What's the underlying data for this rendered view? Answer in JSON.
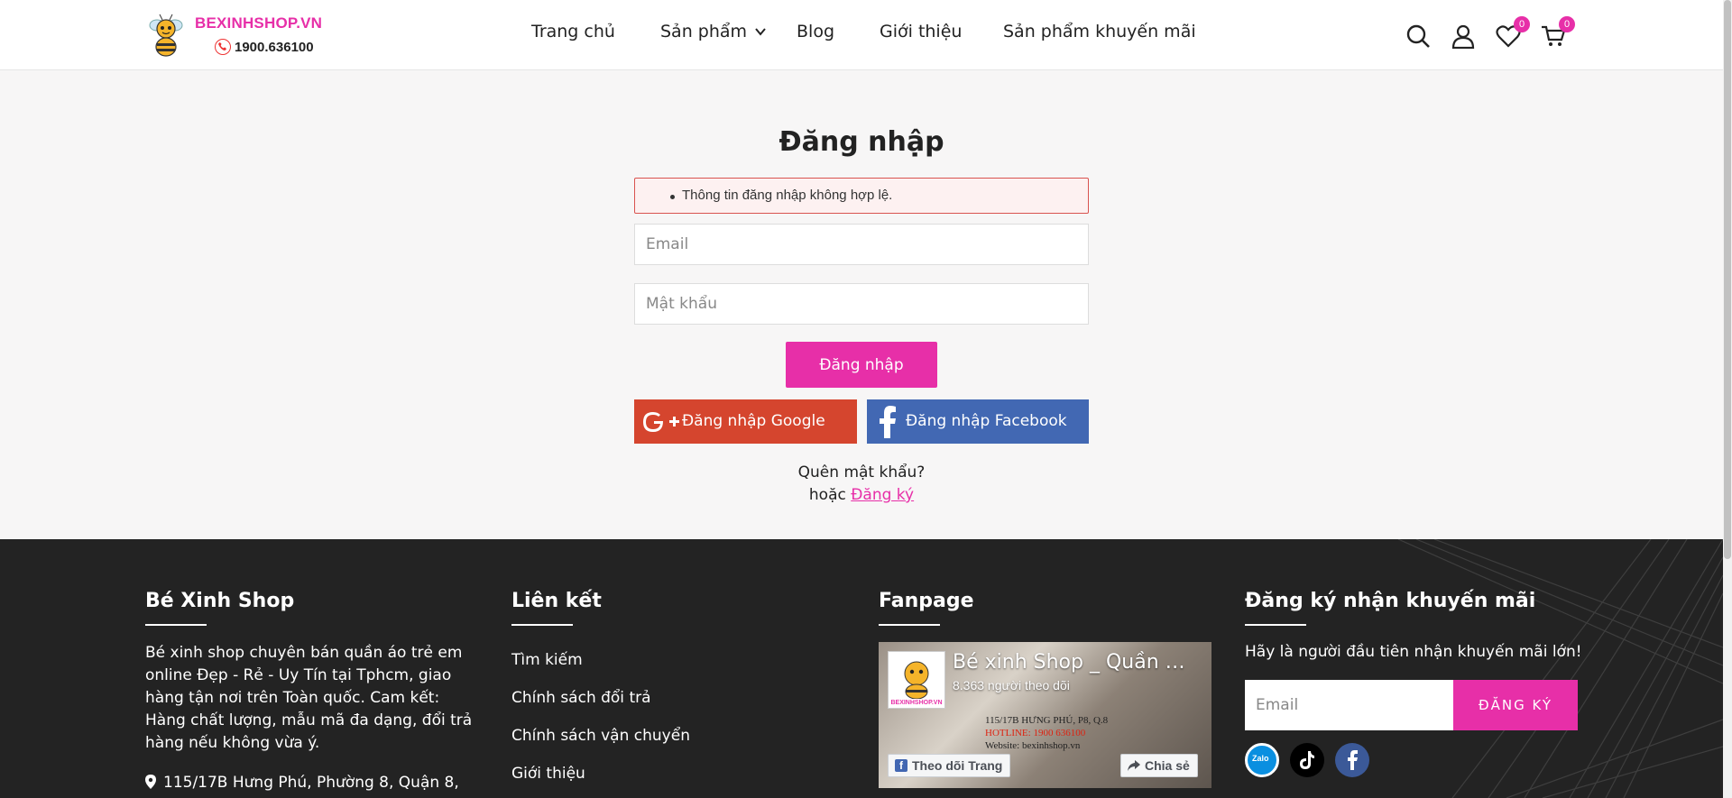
{
  "header": {
    "brand": "BEXINHSHOP.VN",
    "hotline": "1900.636100",
    "nav": [
      "Trang chủ",
      "Sản phẩm",
      "Blog",
      "Giới thiệu",
      "Sản phẩm khuyến mãi"
    ],
    "wishlist_count": "0",
    "cart_count": "0",
    "icons": [
      "search-icon",
      "user-icon",
      "heart-icon",
      "cart-icon"
    ]
  },
  "login": {
    "title": "Đăng nhập",
    "error": "Thông tin đăng nhập không hợp lệ.",
    "email_placeholder": "Email",
    "password_placeholder": "Mật khẩu",
    "submit": "Đăng nhập",
    "google": "Đăng nhập Google",
    "facebook": "Đăng nhập Facebook",
    "forgot": "Quên mật khẩu?",
    "or": "hoặc",
    "register": "Đăng ký"
  },
  "footer": {
    "about_title": "Bé Xinh Shop",
    "about_text": "Bé xinh shop chuyên bán quần áo trẻ em online Đẹp - Rẻ - Uy Tín tại Tphcm, giao hàng tận nơi trên Toàn quốc. Cam kết: Hàng chất lượng, mẫu mã đa dạng, đổi trả hàng nếu không vừa ý.",
    "address": "115/17B Hưng Phú, Phường 8, Quận 8,",
    "links_title": "Liên kết",
    "links": [
      "Tìm kiếm",
      "Chính sách đổi trả",
      "Chính sách vận chuyển",
      "Giới thiệu"
    ],
    "fanpage_title": "Fanpage",
    "fanpage": {
      "name": "Bé xinh Shop _ Quần …",
      "followers": "8.363 người theo dõi",
      "info_lines": [
        "115/17B HƯNG PHÚ, P8, Q.8",
        "HOTLINE: 1900 636100",
        "Website: bexinhshop.vn"
      ],
      "follow": "Theo dõi Trang",
      "share": "Chia sẻ"
    },
    "subscribe_title": "Đăng ký nhận khuyến mãi",
    "subscribe_text": "Hãy là người đầu tiên nhận khuyến mãi lớn!",
    "subscribe_placeholder": "Email",
    "subscribe_button": "ĐĂNG KÝ",
    "social": [
      "zalo-icon",
      "tiktok-icon",
      "facebook-icon"
    ]
  },
  "colors": {
    "accent": "#e72fa8",
    "google": "#d5452e",
    "facebook": "#4268b3",
    "footer_bg": "#232323"
  }
}
